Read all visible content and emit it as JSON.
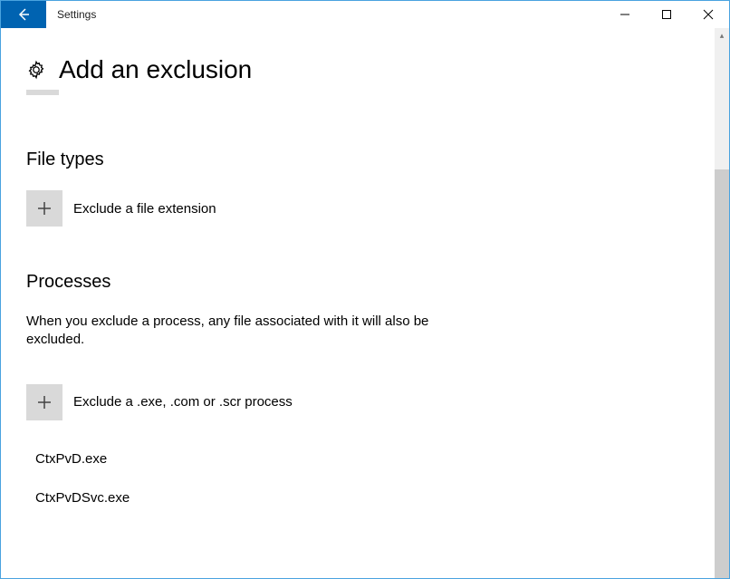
{
  "window": {
    "title": "Settings"
  },
  "page": {
    "title": "Add an exclusion"
  },
  "file_types": {
    "heading": "File types",
    "add_label": "Exclude a file extension"
  },
  "processes": {
    "heading": "Processes",
    "description": "When you exclude a process, any file associated with it will also be excluded.",
    "add_label": "Exclude a .exe, .com or .scr process",
    "items": [
      "CtxPvD.exe",
      "CtxPvDSvc.exe"
    ]
  }
}
